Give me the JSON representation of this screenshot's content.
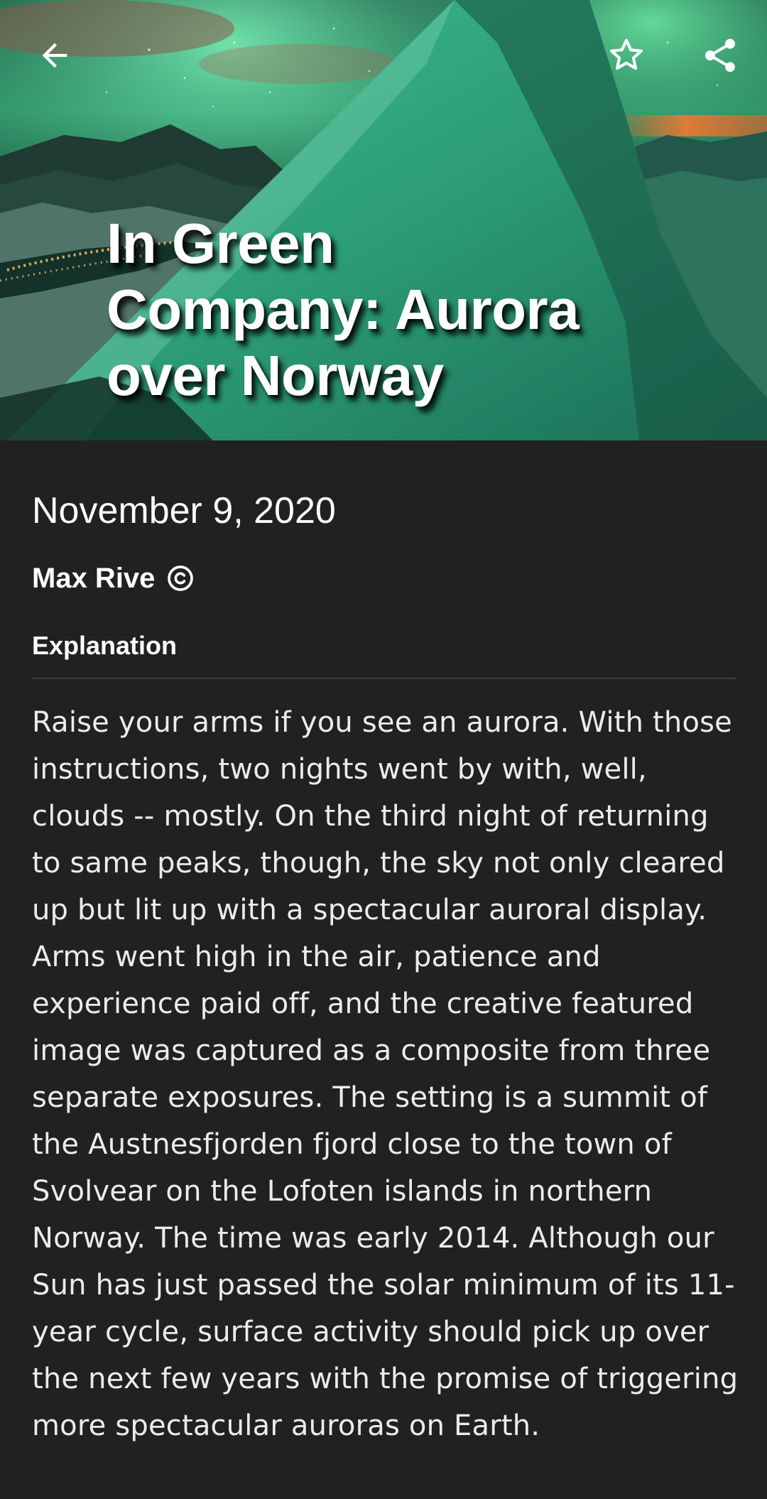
{
  "hero": {
    "title": "In Green Company: Aurora over Norway"
  },
  "toolbar": {
    "back_icon": "arrow-left-icon",
    "favorite_icon": "star-outline-icon",
    "share_icon": "share-icon"
  },
  "article": {
    "date": "November 9, 2020",
    "author": "Max Rive",
    "copyright_icon": "copyright-icon",
    "section_label": "Explanation",
    "explanation": "Raise your arms if you see an aurora. With those instructions, two nights went by with, well, clouds -- mostly. On the third night of returning to same peaks, though, the sky not only cleared up but lit up with a spectacular auroral display. Arms went high in the air, patience and experience paid off, and the creative featured image was captured as a composite from three separate exposures. The setting is a summit of the Austnesfjorden fjord close to the town of Svolvear on the Lofoten islands in northern Norway. The time was early 2014. Although our Sun has just passed the solar minimum of its 11-year cycle, surface activity should pick up over the next few years with the promise of triggering more spectacular auroras on Earth."
  },
  "colors": {
    "background": "#212121",
    "text": "#ffffff",
    "body_text": "#ececec",
    "divider": "#3d3d3d",
    "aurora_green": "#2fae7d"
  }
}
